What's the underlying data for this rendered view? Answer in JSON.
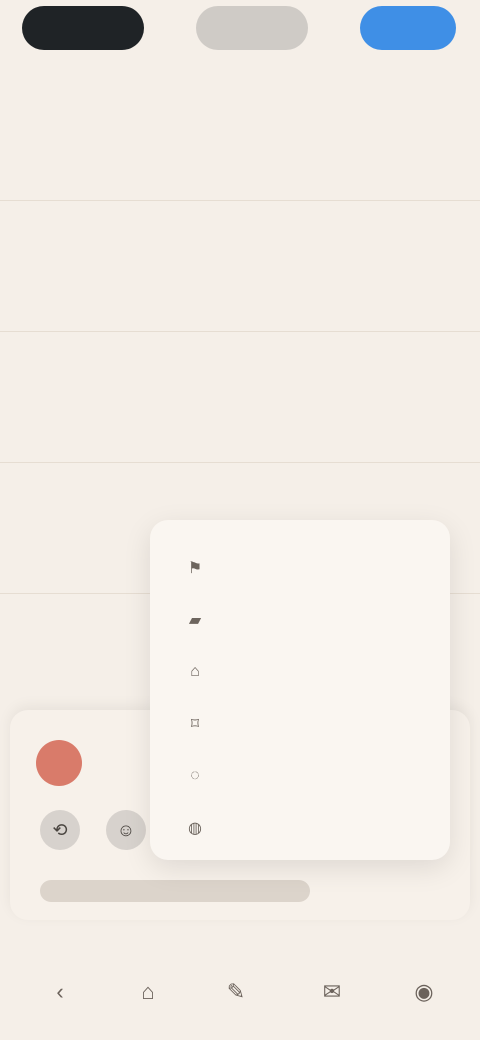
{
  "top_buttons": {
    "left": "",
    "center": "",
    "right": ""
  },
  "list": {
    "rows": [
      {
        "label": "",
        "value": ""
      },
      {
        "label": "",
        "value": ""
      },
      {
        "label": "",
        "value": ""
      },
      {
        "label": "",
        "value": ""
      }
    ]
  },
  "composer": {
    "title": "",
    "input_placeholder": ""
  },
  "menu": {
    "items": [
      "",
      "",
      "",
      "",
      "",
      ""
    ]
  },
  "icons": {
    "menu": [
      "flag-icon",
      "folder-icon",
      "tag-icon",
      "bookmark-icon",
      "user-icon",
      "circle-icon"
    ],
    "nav": [
      "back-icon",
      "home-icon",
      "compose-icon",
      "mail-icon",
      "profile-icon"
    ],
    "composer": [
      "attach-icon",
      "emoji-icon"
    ]
  }
}
